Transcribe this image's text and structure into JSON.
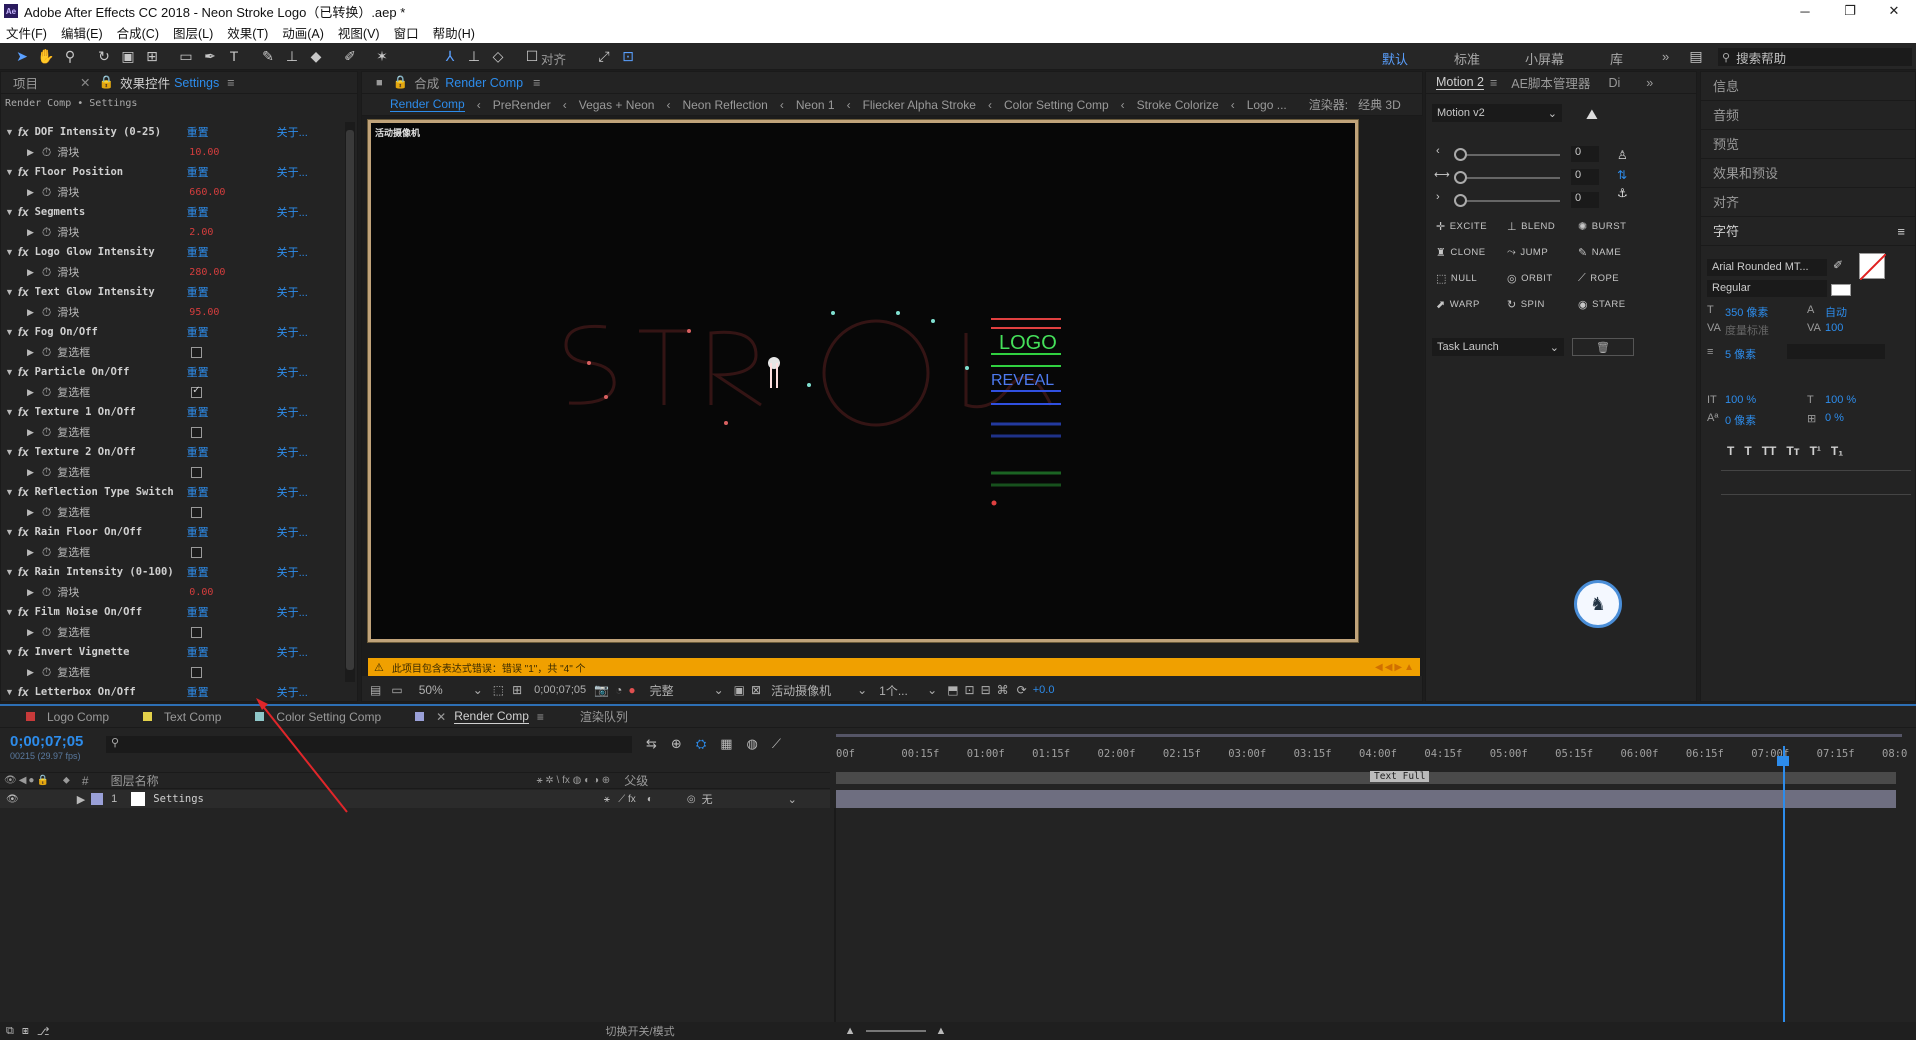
{
  "window": {
    "title": "Adobe After Effects CC 2018 - Neon Stroke Logo（已转换）.aep *",
    "app_icon": "Ae",
    "minimize": "─",
    "maximize": "❐",
    "close": "✕"
  },
  "menu": [
    "文件(F)",
    "编辑(E)",
    "合成(C)",
    "图层(L)",
    "效果(T)",
    "动画(A)",
    "视图(V)",
    "窗口",
    "帮助(H)"
  ],
  "workspaces": {
    "default": "默认",
    "standard": "标准",
    "small": "小屏幕",
    "library": "库",
    "more": "»",
    "search_placeholder": "搜索帮助"
  },
  "left_panel": {
    "tab_project": "项目",
    "tab_effects": "效果控件",
    "tab_effects_target": "Settings",
    "breadcrumb": "Render Comp • Settings",
    "rows": [
      {
        "name": "DOF Intensity (0-25)",
        "reset": "重置",
        "about": "关于...",
        "sub": "滑块",
        "value": "10.00",
        "type": "slider"
      },
      {
        "name": "Floor Position",
        "reset": "重置",
        "about": "关于...",
        "sub": "滑块",
        "value": "660.00",
        "type": "slider"
      },
      {
        "name": "Segments",
        "reset": "重置",
        "about": "关于...",
        "sub": "滑块",
        "value": "2.00",
        "type": "slider"
      },
      {
        "name": "Logo Glow Intensity",
        "reset": "重置",
        "about": "关于...",
        "sub": "滑块",
        "value": "280.00",
        "type": "slider"
      },
      {
        "name": "Text Glow Intensity",
        "reset": "重置",
        "about": "关于...",
        "sub": "滑块",
        "value": "95.00",
        "type": "slider"
      },
      {
        "name": "Fog On/Off",
        "reset": "重置",
        "about": "关于...",
        "sub": "复选框",
        "value": "",
        "type": "check",
        "checked": false
      },
      {
        "name": "Particle On/Off",
        "reset": "重置",
        "about": "关于...",
        "sub": "复选框",
        "value": "",
        "type": "check",
        "checked": true
      },
      {
        "name": "Texture 1 On/Off",
        "reset": "重置",
        "about": "关于...",
        "sub": "复选框",
        "value": "",
        "type": "check",
        "checked": false
      },
      {
        "name": "Texture 2 On/Off",
        "reset": "重置",
        "about": "关于...",
        "sub": "复选框",
        "value": "",
        "type": "check",
        "checked": false
      },
      {
        "name": "Reflection Type Switch",
        "reset": "重置",
        "about": "关于...",
        "sub": "复选框",
        "value": "",
        "type": "check",
        "checked": false
      },
      {
        "name": "Rain Floor On/Off",
        "reset": "重置",
        "about": "关于...",
        "sub": "复选框",
        "value": "",
        "type": "check",
        "checked": false
      },
      {
        "name": "Rain Intensity (0-100)",
        "reset": "重置",
        "about": "关于...",
        "sub": "滑块",
        "value": "0.00",
        "type": "slider"
      },
      {
        "name": "Film Noise On/Off",
        "reset": "重置",
        "about": "关于...",
        "sub": "复选框",
        "value": "",
        "type": "check",
        "checked": false
      },
      {
        "name": "Invert Vignette",
        "reset": "重置",
        "about": "关于...",
        "sub": "复选框",
        "value": "",
        "type": "check",
        "checked": false
      },
      {
        "name": "Letterbox On/Off",
        "reset": "重置",
        "about": "关于...",
        "sub": "",
        "value": "",
        "type": "none"
      }
    ]
  },
  "comp_panel": {
    "label": "合成",
    "comp_name": "Render Comp",
    "tabs": [
      "Render Comp",
      "PreRender",
      "Vegas + Neon",
      "Neon Reflection",
      "Neon 1",
      "Fliecker Alpha Stroke",
      "Color Setting Comp",
      "Stroke Colorize",
      "Logo ..."
    ],
    "renderer_label": "渲染器:",
    "renderer": "经典 3D",
    "camera_label": "活动摄像机",
    "warning": "此项目包含表达式错误：错误 \"1\"，共 \"4\" 个",
    "footer": {
      "zoom": "50%",
      "time": "0;00;07;05",
      "quality": "完整",
      "camera": "活动摄像机",
      "views": "1个...",
      "exposure": "+0.0"
    },
    "logo_text": "LOGO",
    "reveal_text": "REVEAL"
  },
  "motion_panel": {
    "tab1": "Motion 2",
    "tab2": "AE脚本管理器",
    "tab3": "Di",
    "preset": "Motion v2",
    "vals": [
      "0",
      "0",
      "0"
    ],
    "buttons": [
      [
        "EXCITE",
        "BLEND",
        "BURST"
      ],
      [
        "CLONE",
        "JUMP",
        "NAME"
      ],
      [
        "NULL",
        "ORBIT",
        "ROPE"
      ],
      [
        "WARP",
        "SPIN",
        "STARE"
      ]
    ],
    "task": "Task Launch"
  },
  "right_list": {
    "items": [
      "信息",
      "音频",
      "预览",
      "效果和预设",
      "对齐"
    ],
    "char": {
      "title": "字符",
      "font": "Arial Rounded MT...",
      "style": "Regular",
      "size": "350 像素",
      "leading": "自动",
      "kerning": "度量标准",
      "tracking": "100",
      "stroke": "5 像素",
      "vscale": "100 %",
      "hscale": "100 %",
      "baseline": "0 像素",
      "tsume": "0 %",
      "styles": [
        "T",
        "T",
        "TT",
        "Tт",
        "T¹",
        "T₁"
      ]
    }
  },
  "timeline": {
    "tabs": [
      {
        "name": "Logo Comp",
        "color": "#c83a3a"
      },
      {
        "name": "Text Comp",
        "color": "#e3d14a"
      },
      {
        "name": "Color Setting Comp",
        "color": "#8fc7c9"
      },
      {
        "name": "Render Comp",
        "color": "#9aa0d8"
      }
    ],
    "render_queue": "渲染队列",
    "time": "0;00;07;05",
    "fps": "00215 (29.97 fps)",
    "col_name": "图层名称",
    "col_parent": "父级",
    "col_num": "#",
    "layer": {
      "num": "1",
      "name": "Settings",
      "parent": "无"
    },
    "ruler": [
      "00f",
      "00:15f",
      "01:00f",
      "01:15f",
      "02:00f",
      "02:15f",
      "03:00f",
      "03:15f",
      "04:00f",
      "04:15f",
      "05:00f",
      "05:15f",
      "06:00f",
      "06:15f",
      "07:00f",
      "07:15f",
      "08:0"
    ],
    "marker": "Text Full",
    "toggle": "切换开关/模式"
  }
}
